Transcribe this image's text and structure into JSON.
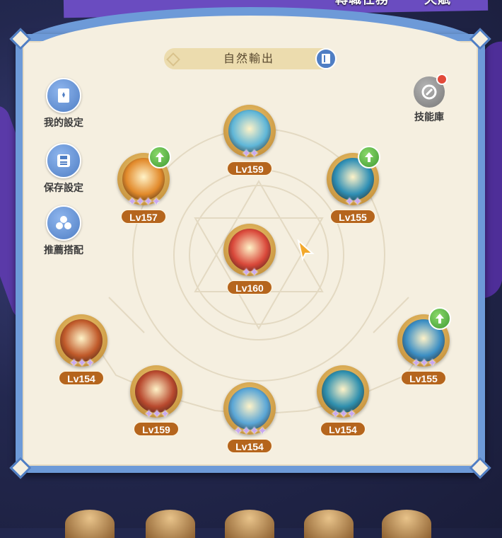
{
  "top_tabs": [
    "轉職任務",
    "天賦"
  ],
  "panel": {
    "title": "自然輸出"
  },
  "side_buttons": [
    {
      "label": "我的設定",
      "icon": "card-icon"
    },
    {
      "label": "保存設定",
      "icon": "save-icon"
    },
    {
      "label": "推薦搭配",
      "icon": "recommend-icon"
    }
  ],
  "library": {
    "label": "技能庫",
    "icon": "skill-library-icon"
  },
  "skills": [
    {
      "id": "top",
      "level": "Lv159",
      "stars": 2,
      "upgrade": false,
      "theme": "#5fb6d8"
    },
    {
      "id": "left",
      "level": "Lv157",
      "stars": 4,
      "upgrade": true,
      "theme": "#e28a2b"
    },
    {
      "id": "right",
      "level": "Lv155",
      "stars": 2,
      "upgrade": true,
      "theme": "#2f8fb5"
    },
    {
      "id": "center",
      "level": "Lv160",
      "stars": 2,
      "upgrade": false,
      "theme": "#d9483a"
    },
    {
      "id": "b1",
      "level": "Lv154",
      "stars": 3,
      "upgrade": false,
      "theme": "#c05a2a"
    },
    {
      "id": "b2",
      "level": "Lv159",
      "stars": 3,
      "upgrade": false,
      "theme": "#b8492e"
    },
    {
      "id": "b3",
      "level": "Lv154",
      "stars": 4,
      "upgrade": false,
      "theme": "#5aa6d6"
    },
    {
      "id": "b4",
      "level": "Lv154",
      "stars": 3,
      "upgrade": false,
      "theme": "#2e8fae"
    },
    {
      "id": "b5",
      "level": "Lv155",
      "stars": 3,
      "upgrade": true,
      "theme": "#3b8ec4"
    }
  ],
  "colors": {
    "panel_border": "#6d9ad8",
    "panel_bg": "#f5efe0",
    "level_badge": "#b5651d",
    "star": "#c9a9f0",
    "upgrade": "#3f9b33"
  }
}
